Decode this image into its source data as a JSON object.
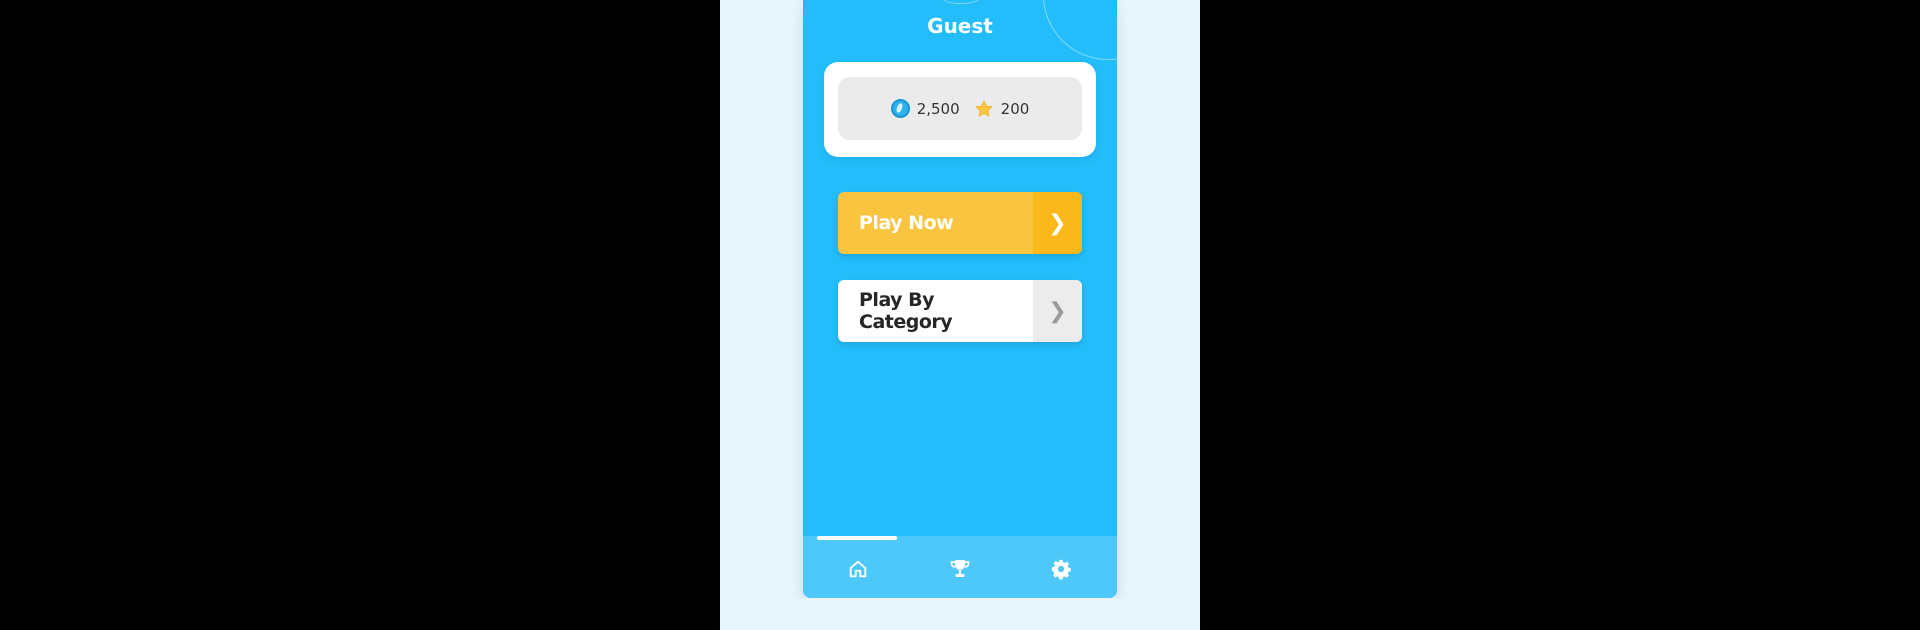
{
  "profile": {
    "name": "Guest"
  },
  "wallet": {
    "coins": "2,500",
    "stars": "200",
    "coin_icon": "coin-icon",
    "star_icon": "star-icon"
  },
  "actions": {
    "play_now_label": "Play Now",
    "play_category_label": "Play By Category",
    "arrow": "❯"
  },
  "nav": {
    "items": [
      {
        "icon": "home-icon",
        "active": true
      },
      {
        "icon": "trophy-icon",
        "active": false
      },
      {
        "icon": "gear-icon",
        "active": false
      }
    ]
  },
  "colors": {
    "primary_bg": "#22bdfa",
    "accent_yellow": "#f9c540",
    "accent_yellow_dark": "#fbb81a",
    "nav_bg": "#4ec8f8"
  }
}
